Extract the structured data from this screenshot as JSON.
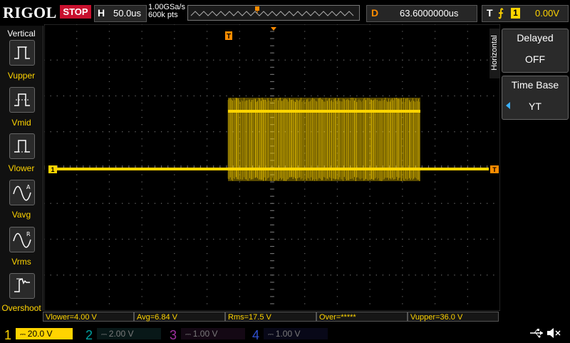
{
  "brand": "RIGOL",
  "run_status": "STOP",
  "horizontal": {
    "key": "H",
    "value": "50.0us"
  },
  "sample": {
    "rate": "1.00GSa/s",
    "points": "600k pts"
  },
  "delay": {
    "key": "D",
    "value": "63.6000000us"
  },
  "trigger": {
    "key": "T",
    "edge": "⨍",
    "channel": "1",
    "level": "0.00V"
  },
  "left_menu": {
    "title": "Vertical",
    "items": [
      {
        "label": "Vupper",
        "icon": "vupper-icon"
      },
      {
        "label": "Vmid",
        "icon": "vmid-icon"
      },
      {
        "label": "Vlower",
        "icon": "vlower-icon"
      },
      {
        "label": "Vavg",
        "icon": "vavg-icon"
      },
      {
        "label": "Vrms",
        "icon": "vrms-icon"
      },
      {
        "label": "Overshoot",
        "icon": "overshoot-icon"
      }
    ]
  },
  "right_menu": {
    "title": "Horizontal",
    "delayed": {
      "title": "Delayed",
      "value": "OFF"
    },
    "timebase": {
      "title": "Time Base",
      "value": "YT"
    }
  },
  "measurements": [
    {
      "label": "Vlower=4.00 V"
    },
    {
      "label": "Avg=6.84 V"
    },
    {
      "label": "Rms=17.5 V"
    },
    {
      "label": "Over=*****"
    },
    {
      "label": "Vupper=36.0 V"
    }
  ],
  "channels": [
    {
      "num": "1",
      "scale": "20.0 V",
      "color": "#ffd400",
      "active": true
    },
    {
      "num": "2",
      "scale": "2.00 V",
      "color": "#00c8c8",
      "active": false
    },
    {
      "num": "3",
      "scale": "1.00 V",
      "color": "#d040d0",
      "active": false
    },
    {
      "num": "4",
      "scale": "1.00 V",
      "color": "#3060ff",
      "active": false
    }
  ],
  "markers": {
    "trigger_pos": "T",
    "channel_marker": "1",
    "trigger_level": "T"
  },
  "colors": {
    "trace": "#ffd400",
    "accent": "#ff8c00",
    "stop": "#c8102e"
  }
}
